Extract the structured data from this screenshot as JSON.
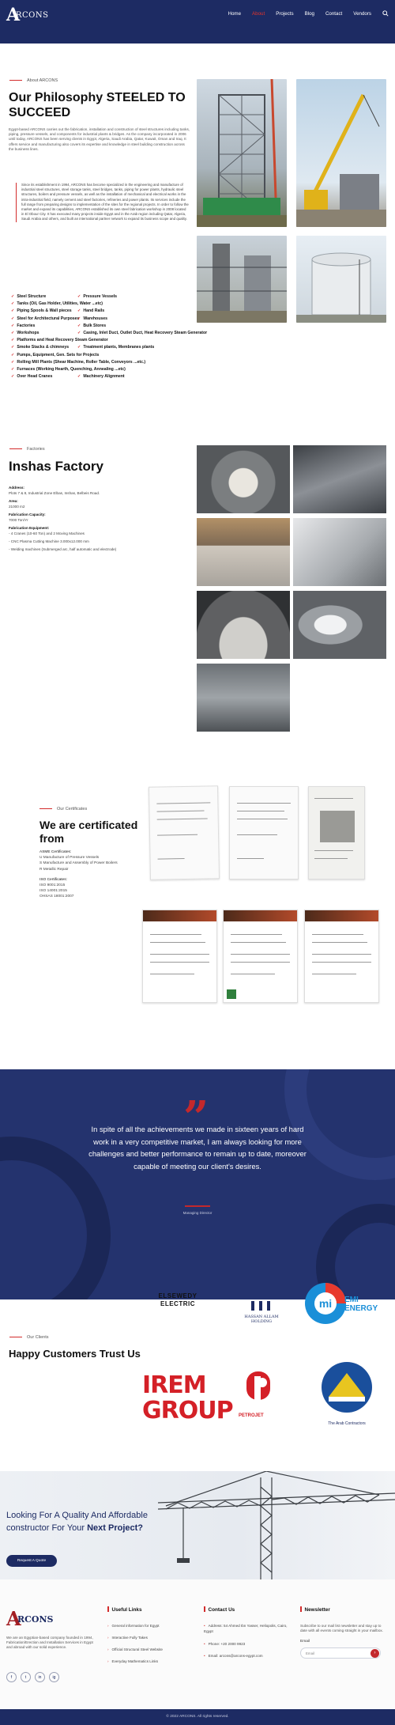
{
  "header": {
    "logo_mark": "A",
    "logo_word": "RCONS",
    "nav": [
      "Home",
      "About",
      "Projects",
      "Blog",
      "Contact",
      "Vendors"
    ],
    "active_nav": "About"
  },
  "about": {
    "tag": "About ARCONS",
    "title": "Our Philosophy STEELED TO SUCCEED",
    "intro": "Egypt-based ARCONS carries out the fabrication, installation and construction of steel structures including tanks, piping, pressure vessels, and components for industrial plants & bridges. As the company incorporated in 2006 until today, ARCONS has been serving clients in Egypt, Algeria, Saudi Arabia, Qatar, Kuwait, Oman and Iraq. It offers service and manufacturing also covers its expertise and knowledge in steel building construction across the business lines.",
    "quote": "Since its establishment in 1994, ARCONS has become specialized in the engineering and manufacture of industrial steel structures, steel storage tanks, steel bridges, tanks, piping for power plants, hydraulic steel structures, boilers and pressure vessels, as well as the installation of mechanical and electrical works in the intra-industrial field, namely cement and steel factories, refineries and power plants. Its services include the full range from preparing designs to implementation of the sites for the regional projects. In order to follow the market and expand its capabilities, ARCONS established its own steel fabrication workshop in 2008 located in El Obour City. It has executed many projects inside Egypt and in the Arab region including Qatar, Algeria, Saudi Arabia and others, and built an international partner network to expand its business scope and quality.",
    "services": [
      "Steel Structure",
      "Pressure Vessels",
      "Tanks (Oil, Gas Holder, Utilities, Water ...etc)",
      "",
      "Piping Spools & Wall pieces",
      "Hand Rails",
      "Steel for Architectural Purposes",
      "Warehouses",
      "Factories",
      "Bulk Stores",
      "Workshops",
      "Casing, Inlet Duct, Outlet Duct, Heat Recovery Steam Generator",
      "Platforms and Heat Recovery Steam Generator",
      "",
      "Smoke Stacks & chimneys",
      "Treatment plants, Membranes plants",
      "Pumps, Equipment, Gen. Sets for Projects",
      "",
      "Rolling Mill Plants (Shear Machine, Roller Table, Conveyors ...etc.)",
      "",
      "Furnaces (Working Hearth, Quenching, Annealing ...etc)",
      "",
      "Over Head Cranes",
      "Machinery Alignment"
    ]
  },
  "factory": {
    "tag": "Factories",
    "title": "Inshas Factory",
    "address_label": "Address:",
    "address": "Plots 7 & 8, Industrial Zone Elbas, Inshas, Belbeis Road.",
    "area_label": "Area:",
    "area": "21000 m2",
    "fab_label": "Fabrication Capacity:",
    "fab": "7000 Ton/Yr",
    "equip_label": "Fabrication Equipment:",
    "equip": [
      "- 4 Cranes (10-60 Ton) and 2 Moving Machines",
      "- CNC Plasma Cutting Machine 3.000x12.000 mm",
      "- Welding machines (Submerged arc, half automatic and electrode)"
    ]
  },
  "certs": {
    "tag": "Our Certificates",
    "title": "We are certificated from",
    "asme_label": "ASME Certificates:",
    "asme": [
      "U Manufacture of Pressure Vessels",
      "S Manufacture and Assembly of Power Boilers",
      "R Metallic Repair"
    ],
    "iso_label": "ISO Certificates:",
    "iso": [
      "ISO 9001:2015",
      "ISO 14001:2015",
      "OHSAS 18001:2007"
    ]
  },
  "quote": {
    "mark": "”",
    "text": "In spite of all the achievements we made in sixteen years of hard work in a very competitive market, I am always looking for more challenges and better performance to remain up to date, moreover capable of meeting our client's desires.",
    "author": "Managing Director"
  },
  "clients": {
    "tag": "Our Clients",
    "title": "Happy Customers Trust Us",
    "logos": [
      "ELSEWEDY ELECTRIC",
      "HASSAN ALLAM HOLDING",
      "EMI ENERGY",
      "IREM GROUP",
      "PETROJET",
      "The Arab Contractors"
    ]
  },
  "cta": {
    "line1": "Looking For A Quality And Affordable",
    "line2_pre": "constructor For Your ",
    "line2_bold": "Next Project?",
    "button": "Request A Quote"
  },
  "footer": {
    "logo_mark": "A",
    "logo_word": "RCONS",
    "about": "We are an Egyptian-based company founded in 1994, Fabrication/Erection and Installation Services in Egypt and abroad with our solid experience.",
    "social": [
      "f",
      "t",
      "in",
      "ig"
    ],
    "useful_title": "Useful Links",
    "useful": [
      "General information for Egypt",
      "Interactive Fully Takes",
      "Official Structural Steel Website",
      "Everyday Mathematics Links"
    ],
    "contact_title": "Contact Us",
    "contact": [
      "Address: 54 Ahmed Ibn Yasser, Heliopolis, Cairo, Egypt",
      "Phone: +20 2000 9923",
      "Email: arcons@arcons-egypt.com"
    ],
    "news_title": "Newsletter",
    "news_text": "Subscribe to our mail list newsletter and stay up to date with all events coming straight in your mailbox.",
    "email_label": "Email",
    "email_placeholder": "Email",
    "copyright": "© 2022 ARCONS. All rights reserved."
  },
  "colors": {
    "brand_navy": "#1d2b63",
    "accent_red": "#d32c2c"
  }
}
